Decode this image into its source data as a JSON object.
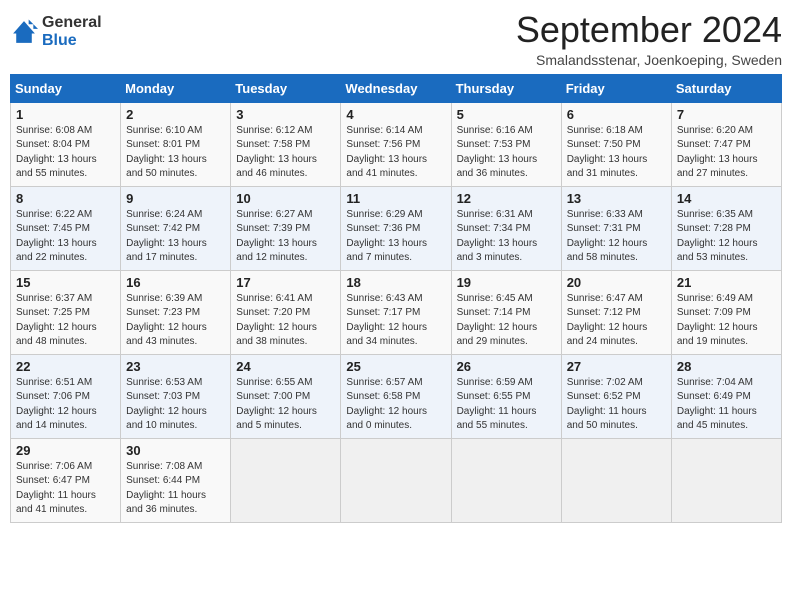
{
  "header": {
    "logo": {
      "general": "General",
      "blue": "Blue"
    },
    "title": "September 2024",
    "subtitle": "Smalandsstenar, Joenkoeping, Sweden"
  },
  "weekdays": [
    "Sunday",
    "Monday",
    "Tuesday",
    "Wednesday",
    "Thursday",
    "Friday",
    "Saturday"
  ],
  "weeks": [
    [
      {
        "day": "1",
        "sunrise": "6:08 AM",
        "sunset": "8:04 PM",
        "daylight": "13 hours and 55 minutes."
      },
      {
        "day": "2",
        "sunrise": "6:10 AM",
        "sunset": "8:01 PM",
        "daylight": "13 hours and 50 minutes."
      },
      {
        "day": "3",
        "sunrise": "6:12 AM",
        "sunset": "7:58 PM",
        "daylight": "13 hours and 46 minutes."
      },
      {
        "day": "4",
        "sunrise": "6:14 AM",
        "sunset": "7:56 PM",
        "daylight": "13 hours and 41 minutes."
      },
      {
        "day": "5",
        "sunrise": "6:16 AM",
        "sunset": "7:53 PM",
        "daylight": "13 hours and 36 minutes."
      },
      {
        "day": "6",
        "sunrise": "6:18 AM",
        "sunset": "7:50 PM",
        "daylight": "13 hours and 31 minutes."
      },
      {
        "day": "7",
        "sunrise": "6:20 AM",
        "sunset": "7:47 PM",
        "daylight": "13 hours and 27 minutes."
      }
    ],
    [
      {
        "day": "8",
        "sunrise": "6:22 AM",
        "sunset": "7:45 PM",
        "daylight": "13 hours and 22 minutes."
      },
      {
        "day": "9",
        "sunrise": "6:24 AM",
        "sunset": "7:42 PM",
        "daylight": "13 hours and 17 minutes."
      },
      {
        "day": "10",
        "sunrise": "6:27 AM",
        "sunset": "7:39 PM",
        "daylight": "13 hours and 12 minutes."
      },
      {
        "day": "11",
        "sunrise": "6:29 AM",
        "sunset": "7:36 PM",
        "daylight": "13 hours and 7 minutes."
      },
      {
        "day": "12",
        "sunrise": "6:31 AM",
        "sunset": "7:34 PM",
        "daylight": "13 hours and 3 minutes."
      },
      {
        "day": "13",
        "sunrise": "6:33 AM",
        "sunset": "7:31 PM",
        "daylight": "12 hours and 58 minutes."
      },
      {
        "day": "14",
        "sunrise": "6:35 AM",
        "sunset": "7:28 PM",
        "daylight": "12 hours and 53 minutes."
      }
    ],
    [
      {
        "day": "15",
        "sunrise": "6:37 AM",
        "sunset": "7:25 PM",
        "daylight": "12 hours and 48 minutes."
      },
      {
        "day": "16",
        "sunrise": "6:39 AM",
        "sunset": "7:23 PM",
        "daylight": "12 hours and 43 minutes."
      },
      {
        "day": "17",
        "sunrise": "6:41 AM",
        "sunset": "7:20 PM",
        "daylight": "12 hours and 38 minutes."
      },
      {
        "day": "18",
        "sunrise": "6:43 AM",
        "sunset": "7:17 PM",
        "daylight": "12 hours and 34 minutes."
      },
      {
        "day": "19",
        "sunrise": "6:45 AM",
        "sunset": "7:14 PM",
        "daylight": "12 hours and 29 minutes."
      },
      {
        "day": "20",
        "sunrise": "6:47 AM",
        "sunset": "7:12 PM",
        "daylight": "12 hours and 24 minutes."
      },
      {
        "day": "21",
        "sunrise": "6:49 AM",
        "sunset": "7:09 PM",
        "daylight": "12 hours and 19 minutes."
      }
    ],
    [
      {
        "day": "22",
        "sunrise": "6:51 AM",
        "sunset": "7:06 PM",
        "daylight": "12 hours and 14 minutes."
      },
      {
        "day": "23",
        "sunrise": "6:53 AM",
        "sunset": "7:03 PM",
        "daylight": "12 hours and 10 minutes."
      },
      {
        "day": "24",
        "sunrise": "6:55 AM",
        "sunset": "7:00 PM",
        "daylight": "12 hours and 5 minutes."
      },
      {
        "day": "25",
        "sunrise": "6:57 AM",
        "sunset": "6:58 PM",
        "daylight": "12 hours and 0 minutes."
      },
      {
        "day": "26",
        "sunrise": "6:59 AM",
        "sunset": "6:55 PM",
        "daylight": "11 hours and 55 minutes."
      },
      {
        "day": "27",
        "sunrise": "7:02 AM",
        "sunset": "6:52 PM",
        "daylight": "11 hours and 50 minutes."
      },
      {
        "day": "28",
        "sunrise": "7:04 AM",
        "sunset": "6:49 PM",
        "daylight": "11 hours and 45 minutes."
      }
    ],
    [
      {
        "day": "29",
        "sunrise": "7:06 AM",
        "sunset": "6:47 PM",
        "daylight": "11 hours and 41 minutes."
      },
      {
        "day": "30",
        "sunrise": "7:08 AM",
        "sunset": "6:44 PM",
        "daylight": "11 hours and 36 minutes."
      },
      null,
      null,
      null,
      null,
      null
    ]
  ]
}
